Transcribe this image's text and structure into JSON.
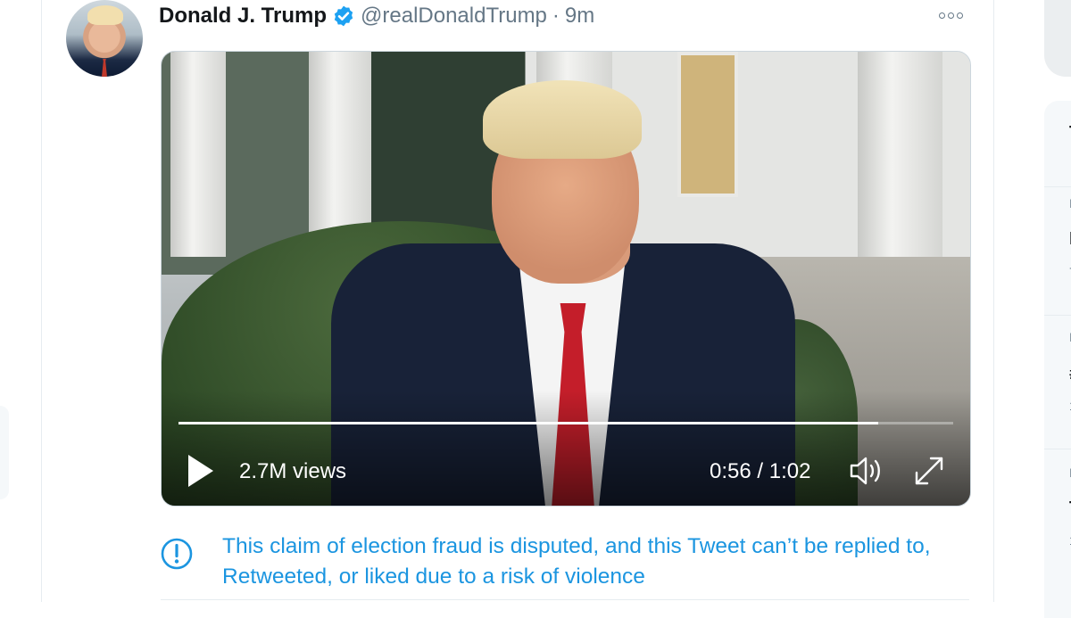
{
  "tweet": {
    "author_name": "Donald J. Trump",
    "handle": "@realDonaldTrump",
    "separator": "·",
    "time": "9m"
  },
  "video": {
    "views": "2.7M views",
    "timecode": "0:56 / 1:02",
    "progress": 0.903
  },
  "notice": {
    "text": "This claim of election fraud is disputed, and this Tweet can’t be replied to, Retweeted, or liked due to a risk of violence"
  },
  "colors": {
    "accent": "#1da1f2",
    "notice": "#1b95e0",
    "muted": "#657786",
    "text": "#14171a"
  },
  "icons": [
    "verified-badge-icon",
    "more-icon",
    "play-icon",
    "volume-icon",
    "fullscreen-icon",
    "info-icon"
  ]
}
